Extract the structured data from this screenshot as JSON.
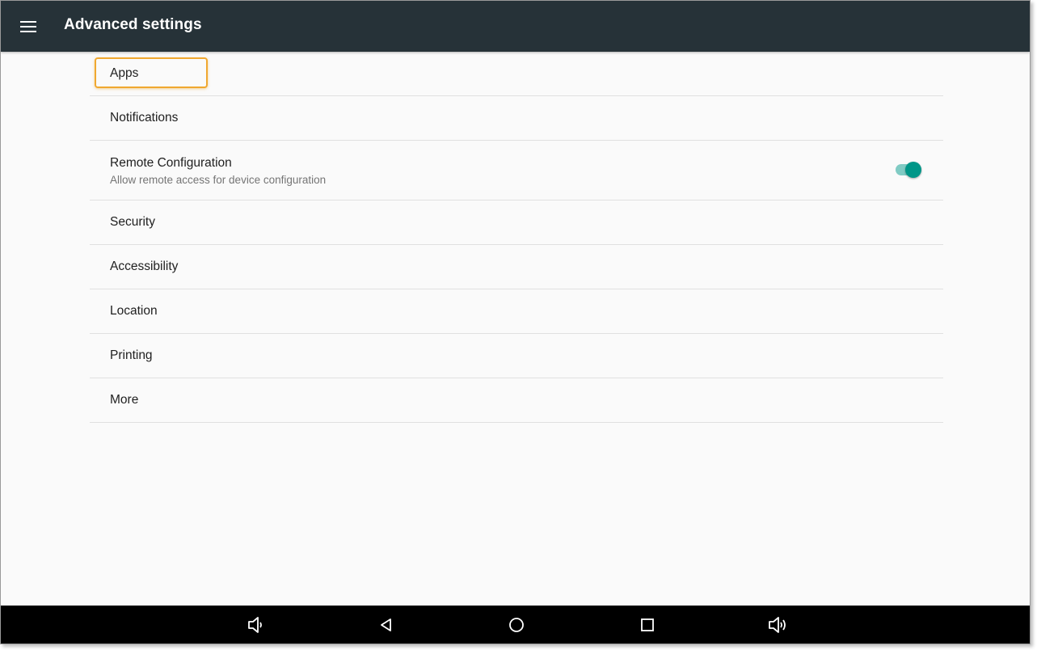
{
  "appbar": {
    "title": "Advanced settings",
    "menu_icon": "hamburger-menu-icon",
    "color": "#263238"
  },
  "list": {
    "items": [
      {
        "label": "Apps",
        "highlighted": true
      },
      {
        "label": "Notifications"
      },
      {
        "label": "Remote Configuration",
        "subtitle": "Allow remote access for device configuration",
        "toggle": {
          "state": "on",
          "accent": "#009688"
        }
      },
      {
        "label": "Security"
      },
      {
        "label": "Accessibility"
      },
      {
        "label": "Location"
      },
      {
        "label": "Printing"
      },
      {
        "label": "More"
      }
    ]
  },
  "navbar": {
    "buttons": [
      {
        "icon": "volume-down-icon"
      },
      {
        "icon": "back-icon"
      },
      {
        "icon": "home-icon"
      },
      {
        "icon": "recents-icon"
      },
      {
        "icon": "volume-up-icon"
      }
    ]
  },
  "colors": {
    "highlight": "#f0a830",
    "background": "#fafafa"
  }
}
